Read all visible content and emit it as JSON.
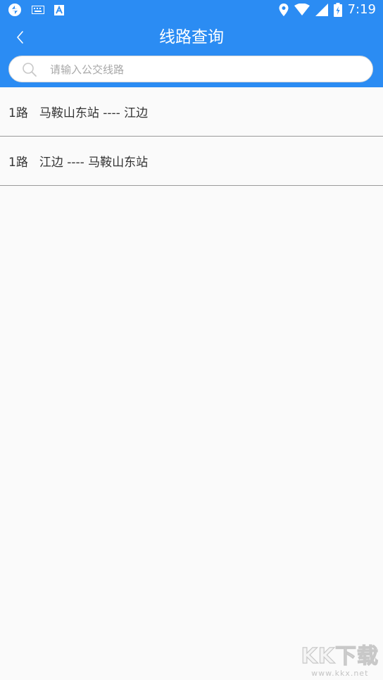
{
  "status_bar": {
    "time": "7:19",
    "left_icons": [
      "sync-icon",
      "keyboard-icon",
      "font-a-icon"
    ],
    "right_icons": [
      "location-icon",
      "wifi-icon",
      "signal-icon",
      "battery-icon"
    ]
  },
  "header": {
    "title": "线路查询",
    "back_icon": "chevron-left-icon",
    "color": "#2b8cf3"
  },
  "search": {
    "placeholder": "请输入公交线路",
    "value": "",
    "icon": "search-icon"
  },
  "routes": [
    {
      "route": "1路",
      "direction": "马鞍山东站 ---- 江边"
    },
    {
      "route": "1路",
      "direction": "江边 ---- 马鞍山东站"
    }
  ],
  "watermark": {
    "main": "KK下载",
    "sub": "www.kkx.net"
  }
}
